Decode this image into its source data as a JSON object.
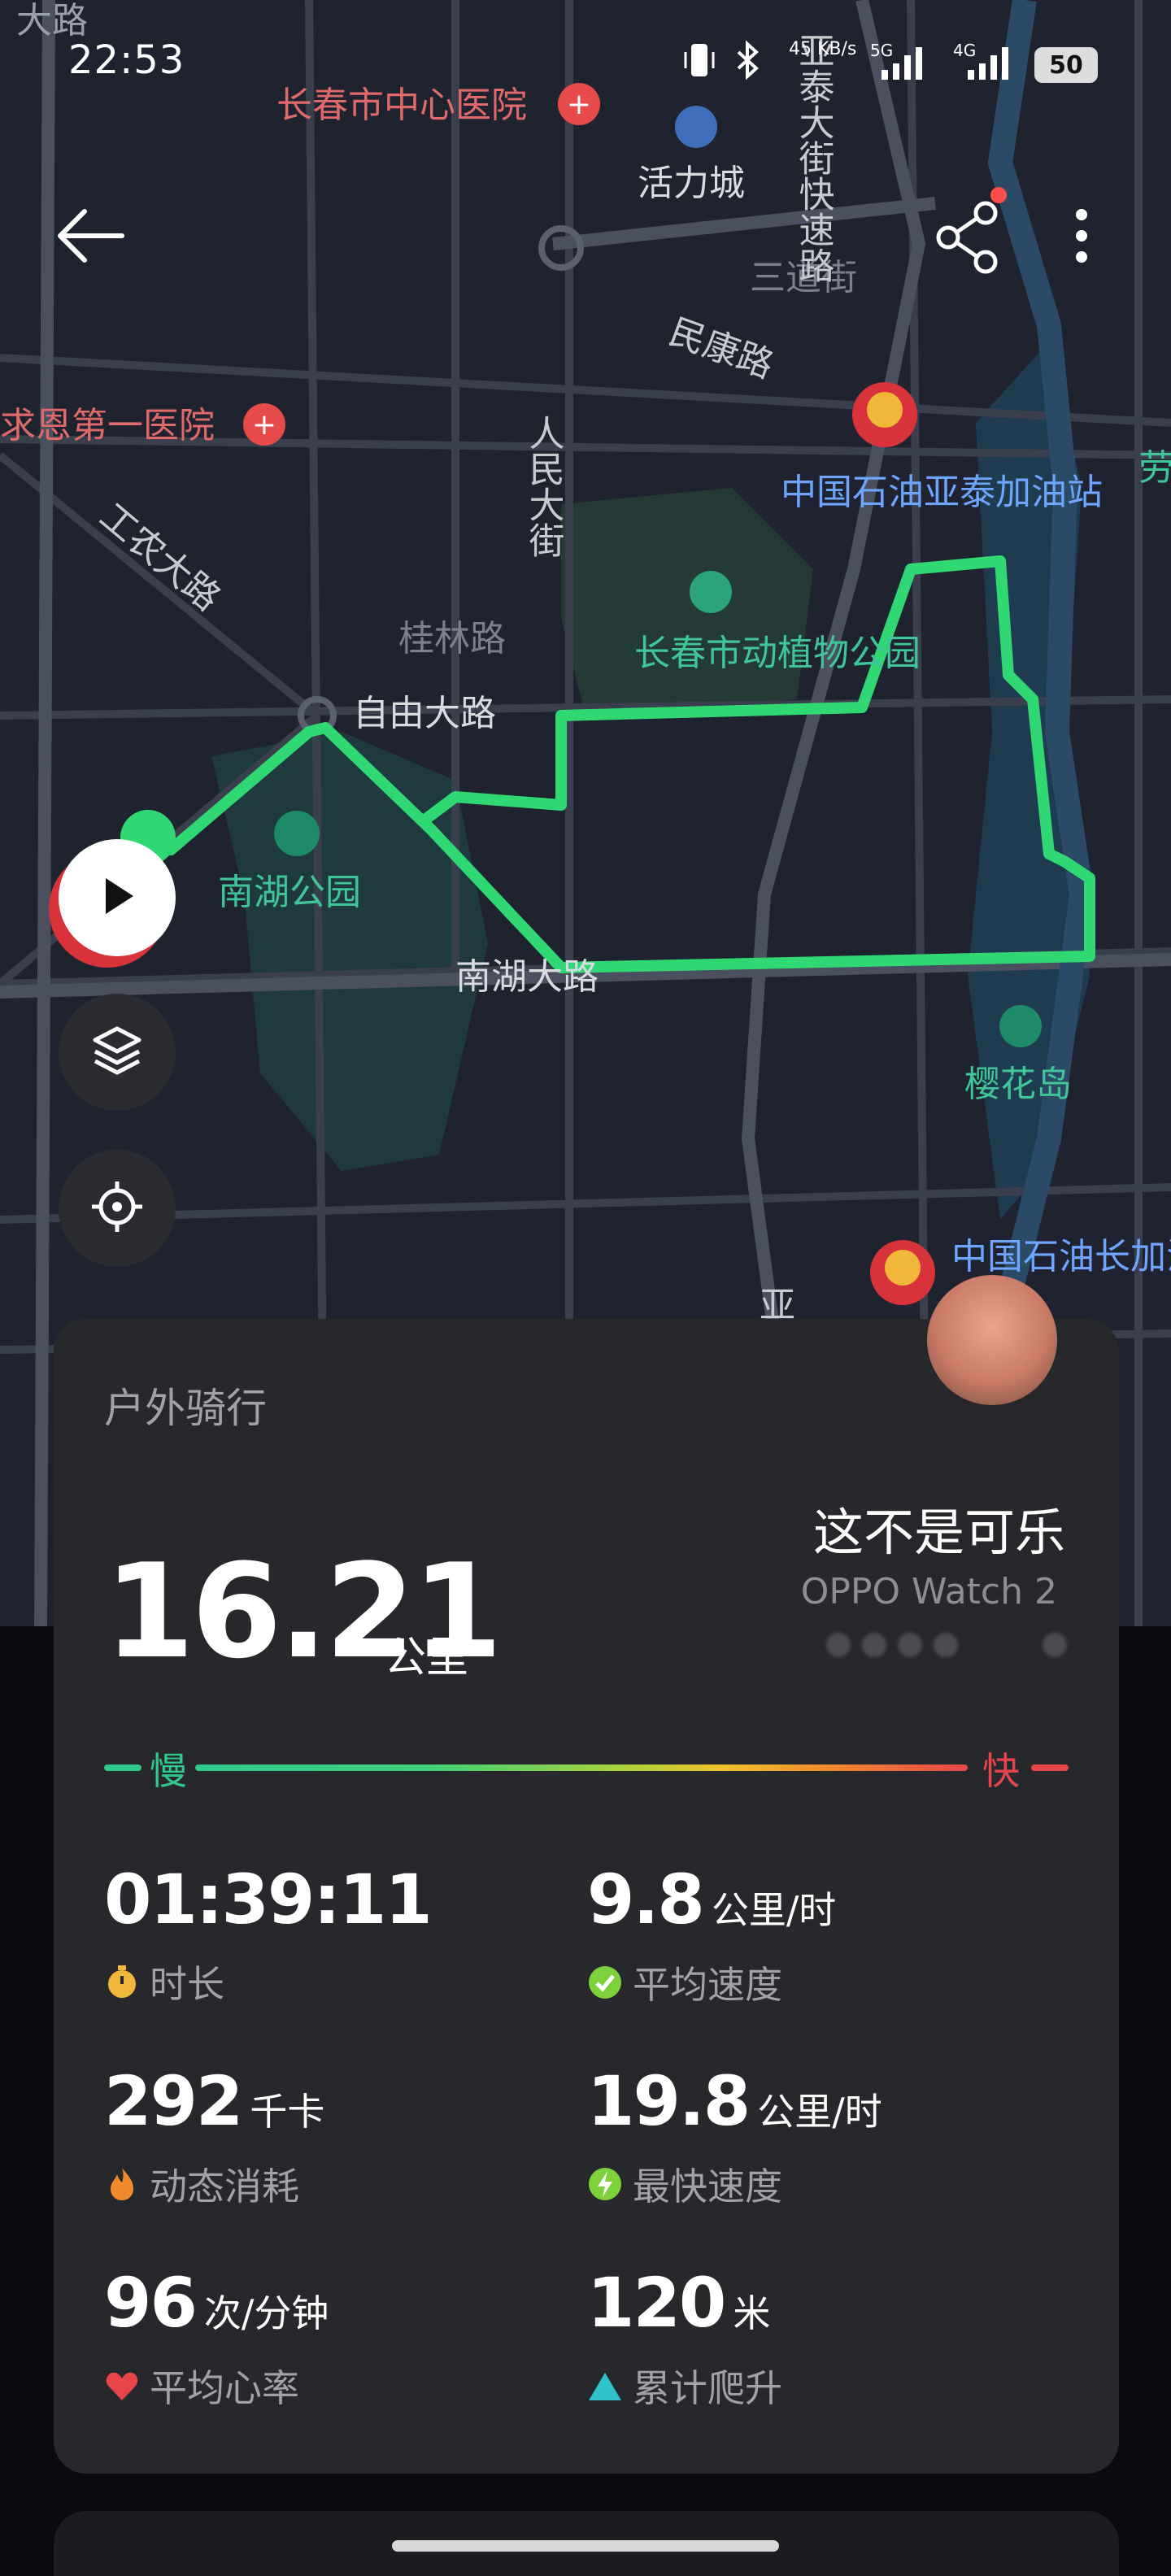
{
  "status_bar": {
    "time": "22:53",
    "net_speed": "45 KB/s",
    "net_type_1": "5G",
    "net_type_2": "4G",
    "battery": "50"
  },
  "map_labels": {
    "hospital_1": "长春市中心医院",
    "mall": "活力城",
    "street_sandao": "三道街",
    "road_minkang": "民康路",
    "hospital_2": "求恩第一医院",
    "street_renmin": "人民大街",
    "gas_station_1": "中国石油亚泰加油站",
    "road_gongnong": "工农大路",
    "road_guilin": "桂林路",
    "zoo": "长春市动植物公园",
    "road_ziyou": "自由大路",
    "park_nanhu": "南湖公园",
    "road_nanhu": "南湖大路",
    "island_yinghua": "樱花岛",
    "gas_station_2": "中国石油长加油站",
    "street_ya": "亚",
    "expressway_left": "亚泰大街快速路",
    "edge_top": "大路",
    "edge_right": "劳"
  },
  "workout": {
    "type": "户外骑行",
    "distance": "16.21",
    "distance_unit": "公里",
    "user_name": "这不是可乐",
    "device": "OPPO Watch 2",
    "scale_slow": "慢",
    "scale_fast": "快",
    "stats": [
      {
        "value": "01:39:11",
        "unit": "",
        "label": "时长",
        "icon": "stopwatch-icon"
      },
      {
        "value": "9.8",
        "unit": "公里/时",
        "label": "平均速度",
        "icon": "check-circle-icon"
      },
      {
        "value": "292",
        "unit": "千卡",
        "label": "动态消耗",
        "icon": "flame-icon"
      },
      {
        "value": "19.8",
        "unit": "公里/时",
        "label": "最快速度",
        "icon": "lightning-icon"
      },
      {
        "value": "96",
        "unit": "次/分钟",
        "label": "平均心率",
        "icon": "heart-icon"
      },
      {
        "value": "120",
        "unit": "米",
        "label": "累计爬升",
        "icon": "triangle-icon"
      }
    ]
  },
  "colors": {
    "route": "#2fd873",
    "slow": "#2fc98d",
    "fast": "#e8454b",
    "card_bg": "#27282b",
    "map_bg": "#1f2330"
  }
}
